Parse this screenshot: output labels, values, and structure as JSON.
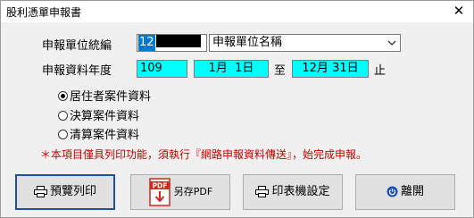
{
  "window": {
    "title": "股利憑單申報書",
    "close_glyph": "✕"
  },
  "form": {
    "unit_id_label": "申報單位統編",
    "unit_id_value": "12",
    "unit_name_value": "申報單位名稱",
    "year_label": "申報資料年度",
    "year_value": "109",
    "date_from": "1月  1日",
    "date_to_sep": "至",
    "date_to": "12月 31日",
    "date_end_sep": "止"
  },
  "options": [
    {
      "label": "居住者案件資料",
      "checked": true
    },
    {
      "label": "決算案件資料",
      "checked": false
    },
    {
      "label": "清算案件資料",
      "checked": false
    }
  ],
  "warning": "＊本項目僅具列印功能，須執行『網路申報資料傳送』，始完成申報。",
  "buttons": {
    "preview": "預覽列印",
    "save_pdf": "另存PDF",
    "pdf_icon_text": "PDF",
    "printer_setup": "印表機設定",
    "exit": "離開"
  },
  "colors": {
    "field_cyan": "#00ffff",
    "focus_blue": "#1e50a2",
    "warning_red": "#cc0000"
  }
}
